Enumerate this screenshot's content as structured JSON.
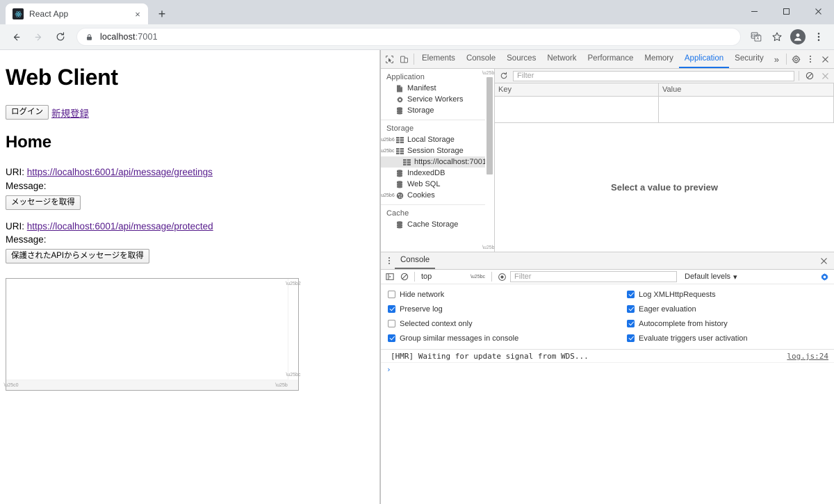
{
  "window": {
    "minimize_label": "Minimize",
    "maximize_label": "Maximize",
    "close_label": "Close"
  },
  "tab": {
    "title": "React App",
    "close_label": "×",
    "new_tab_label": "+"
  },
  "address_bar": {
    "back_label": "←",
    "forward_label": "→",
    "reload_label": "⟳",
    "url_host": "localhost",
    "url_port": ":7001"
  },
  "page": {
    "title": "Web Client",
    "login_button": "ログイン",
    "register_link": "新規登録",
    "heading": "Home",
    "sections": [
      {
        "uri_label": "URI: ",
        "uri": "https://localhost:6001/api/message/greetings",
        "message_label": "Message:",
        "button": "メッセージを取得"
      },
      {
        "uri_label": "URI: ",
        "uri": "https://localhost:6001/api/message/protected",
        "message_label": "Message:",
        "button": "保護されたAPIからメッセージを取得"
      }
    ],
    "textarea_value": ""
  },
  "devtools": {
    "tabs": [
      {
        "label": "Elements",
        "active": false
      },
      {
        "label": "Console",
        "active": false
      },
      {
        "label": "Sources",
        "active": false
      },
      {
        "label": "Network",
        "active": false
      },
      {
        "label": "Performance",
        "active": false
      },
      {
        "label": "Memory",
        "active": false
      },
      {
        "label": "Application",
        "active": true
      },
      {
        "label": "Security",
        "active": false
      }
    ],
    "overflow_label": "»",
    "close_label": "×",
    "application": {
      "sections": [
        {
          "title": "Application",
          "items": [
            {
              "label": "Manifest",
              "icon": "document-icon",
              "expander": "none",
              "selected": false
            },
            {
              "label": "Service Workers",
              "icon": "gear-icon",
              "expander": "none",
              "selected": false
            },
            {
              "label": "Storage",
              "icon": "database-icon",
              "expander": "none",
              "selected": false
            }
          ]
        },
        {
          "title": "Storage",
          "items": [
            {
              "label": "Local Storage",
              "icon": "table-icon",
              "expander": "collapsed",
              "selected": false
            },
            {
              "label": "Session Storage",
              "icon": "table-icon",
              "expander": "expanded",
              "selected": false
            },
            {
              "label": "https://localhost:7001",
              "icon": "table-icon",
              "expander": "none",
              "selected": true,
              "indent": 2
            },
            {
              "label": "IndexedDB",
              "icon": "database-icon",
              "expander": "none",
              "selected": false
            },
            {
              "label": "Web SQL",
              "icon": "database-icon",
              "expander": "none",
              "selected": false
            },
            {
              "label": "Cookies",
              "icon": "cookie-icon",
              "expander": "collapsed",
              "selected": false
            }
          ]
        },
        {
          "title": "Cache",
          "items": [
            {
              "label": "Cache Storage",
              "icon": "database-icon",
              "expander": "none",
              "selected": false
            }
          ]
        }
      ],
      "toolbar": {
        "refresh_label": "Refresh",
        "filter_placeholder": "Filter",
        "clear_label": "Clear",
        "delete_label": "Delete selected"
      },
      "table": {
        "columns": [
          "Key",
          "Value"
        ],
        "rows": []
      },
      "preview_placeholder": "Select a value to preview"
    },
    "console_drawer": {
      "tab_label": "Console",
      "close_label": "×",
      "toolbar": {
        "sidebar_label": "Show console sidebar",
        "clear_label": "Clear console",
        "context": "top",
        "eye_label": "Create live expression",
        "filter_placeholder": "Filter",
        "levels": "Default levels",
        "levels_caret": "▾",
        "settings_label": "Console settings"
      },
      "settings": [
        {
          "label": "Hide network",
          "checked": false,
          "column": "left"
        },
        {
          "label": "Preserve log",
          "checked": true,
          "column": "left"
        },
        {
          "label": "Selected context only",
          "checked": false,
          "column": "left"
        },
        {
          "label": "Group similar messages in console",
          "checked": true,
          "column": "left"
        },
        {
          "label": "Log XMLHttpRequests",
          "checked": true,
          "column": "right"
        },
        {
          "label": "Eager evaluation",
          "checked": true,
          "column": "right"
        },
        {
          "label": "Autocomplete from history",
          "checked": true,
          "column": "right"
        },
        {
          "label": "Evaluate triggers user activation",
          "checked": true,
          "column": "right"
        }
      ],
      "messages": [
        {
          "text": "[HMR] Waiting for update signal from WDS...",
          "source": "log.js:24"
        }
      ],
      "prompt_caret": "›"
    }
  }
}
